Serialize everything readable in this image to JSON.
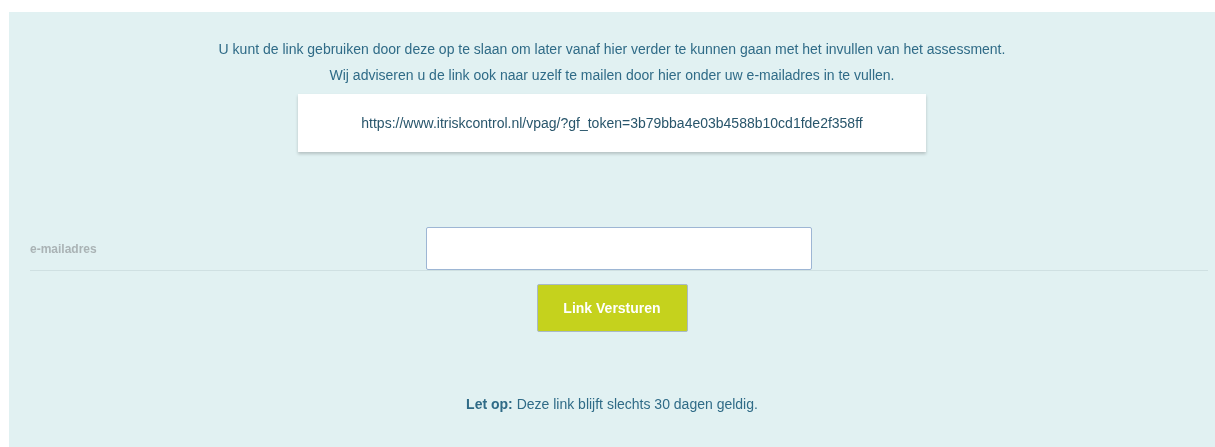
{
  "intro": [
    "U kunt de link gebruiken door deze op te slaan om later vanaf hier verder te kunnen gaan met het invullen van het assessment.",
    "Wij adviseren u de link ook naar uzelf te mailen door hier onder uw e-mailadres in te vullen."
  ],
  "link": "https://www.itriskcontrol.nl/vpag/?gf_token=3b79bba4e03b4588b10cd1fde2f358ff",
  "email_field": {
    "label": "e-mailadres"
  },
  "button": "Link Versturen",
  "note": "**Let op:** Deze link blijft slechts 30 dagen geldig."
}
